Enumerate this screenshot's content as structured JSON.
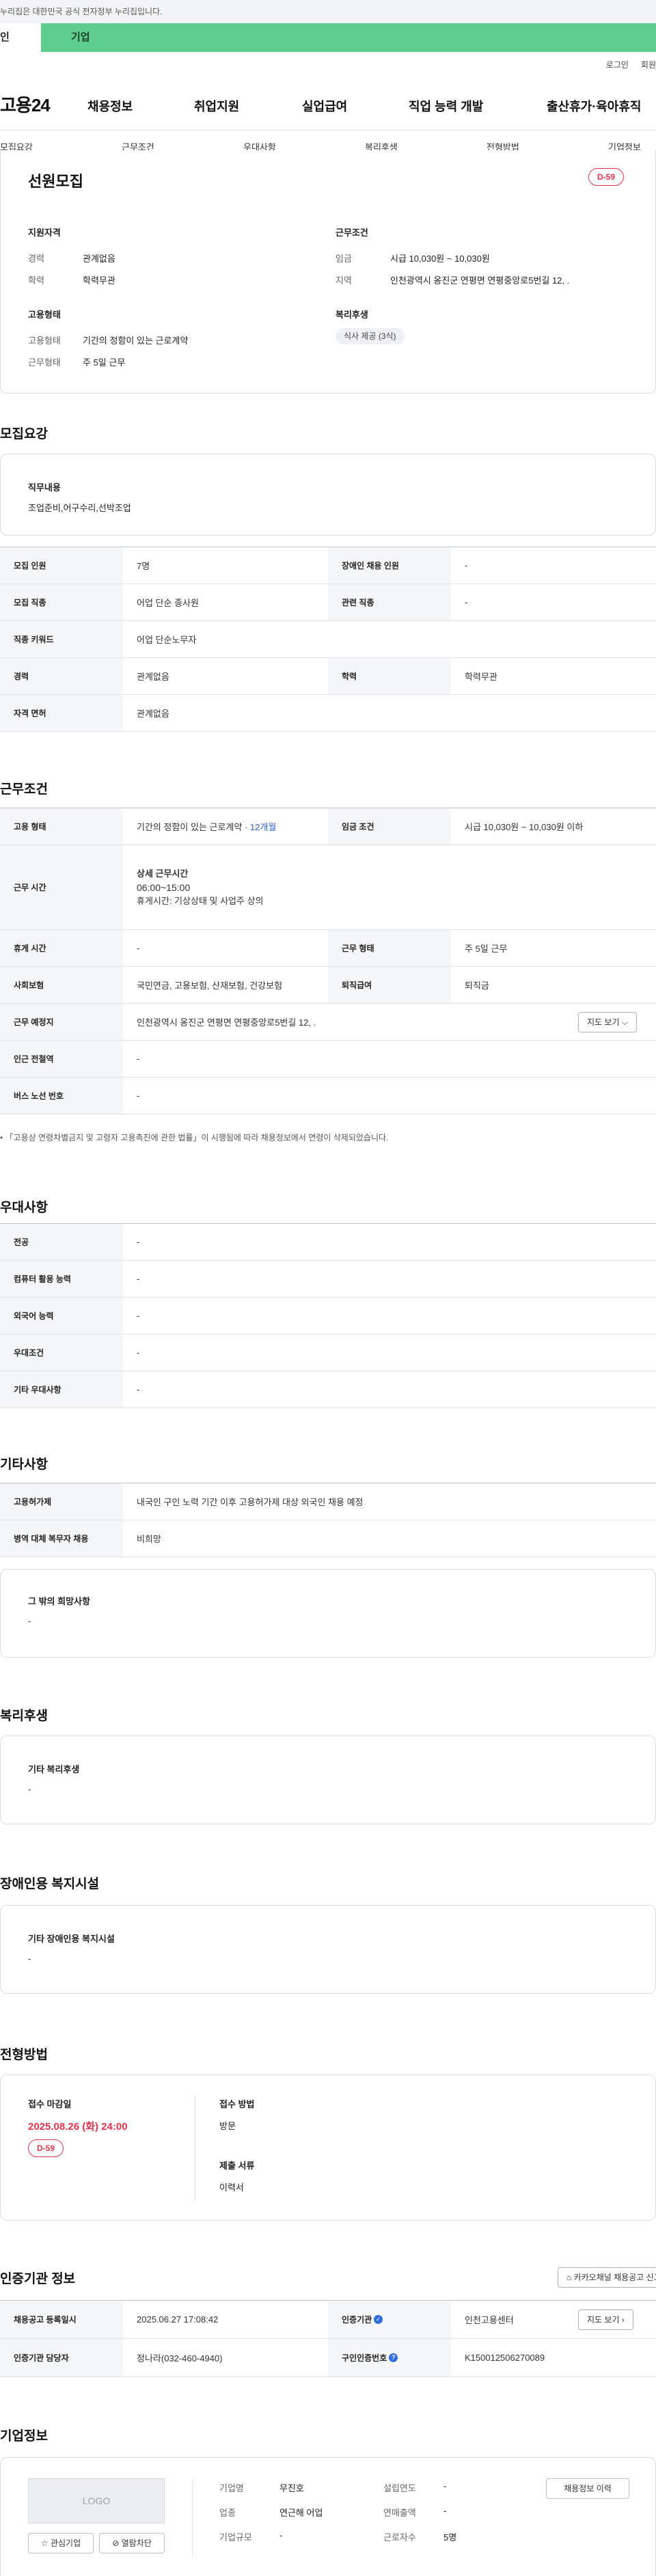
{
  "banner": {
    "gov_text": "누리집은 대한민국 공식 전자정부 누리집입니다."
  },
  "tabs": {
    "individual": "인",
    "company": "기업"
  },
  "util": {
    "login": "로그인",
    "join": "회원"
  },
  "header": {
    "logo": "고용24",
    "gnb": [
      "채용정보",
      "취업지원",
      "실업급여",
      "직업 능력 개발",
      "출산휴가·육아휴직"
    ]
  },
  "subnav": [
    "모집요강",
    "근무조건",
    "우대사항",
    "복리후생",
    "전형방법",
    "기업정보"
  ],
  "summary": {
    "title": "선원모집",
    "dday": "D-59",
    "qual_heading": "지원자격",
    "career_k": "경력",
    "career_v": "관계없음",
    "edu_k": "학력",
    "edu_v": "학력무관",
    "emp_heading": "고용형태",
    "emptype_k": "고용형태",
    "emptype_v": "기간의 정함이 있는 근로계약",
    "workdays_k": "근무형태",
    "workdays_v": "주 5일 근무",
    "cond_heading": "근무조건",
    "wage_k": "임금",
    "wage_v": "시급 10,030원 ~ 10,030원",
    "region_k": "지역",
    "region_v": "인천광역시 옹진군 연평면 연평중앙로5번길 12, .",
    "welfare_heading": "복리후생",
    "welfare_chip": "식사 제공 (3식)"
  },
  "recruit": {
    "heading": "모집요강",
    "duty_heading": "직무내용",
    "duty_text": "조업준비,어구수리,선박조업",
    "rows": {
      "count_k": "모집 인원",
      "count_v": "7명",
      "disabled_k": "장애인 채용 인원",
      "disabled_v": "-",
      "job_k": "모집 직종",
      "job_v": "어업 단순 종사원",
      "related_k": "관련 직종",
      "related_v": "-",
      "keyword_k": "직종 키워드",
      "keyword_v": "어업 단순노무자",
      "career_k": "경력",
      "career_v": "관계없음",
      "edu_k": "학력",
      "edu_v": "학력무관",
      "license_k": "자격 면허",
      "license_v": "관계없음"
    }
  },
  "work": {
    "heading": "근무조건",
    "emp_k": "고용 형태",
    "emp_v": "기간의 정함이 있는 근로계약 ·",
    "emp_months": "12개월",
    "wage_k": "임금 조건",
    "wage_v": "시급 10,030원 ~ 10,030원 이하",
    "hours_k": "근무 시간",
    "hours_title": "상세 근무시간",
    "hours_time": "06:00~15:00",
    "hours_rest": "휴게시간: 기상상태 및 사업주 상의",
    "rest_k": "휴게 시간",
    "rest_v": "-",
    "form_k": "근무 형태",
    "form_v": "주 5일 근무",
    "insurance_k": "사회보험",
    "insurance_v": "국민연금, 고용보험, 산재보험, 건강보험",
    "severance_k": "퇴직급여",
    "severance_v": "퇴직금",
    "place_k": "근무 예정지",
    "place_v": "인천광역시 옹진군 연평면 연평중앙로5번길 12, .",
    "map_btn": "지도 보기",
    "station_k": "인근 전철역",
    "station_v": "-",
    "bus_k": "버스 노선 번호",
    "bus_v": "-",
    "note": "「고용상 연령차별금지 및 고령자 고용촉진에 관한 법률」이 시행됨에 따라 채용정보에서 연령이 삭제되었습니다."
  },
  "prefer": {
    "heading": "우대사항",
    "major_k": "전공",
    "major_v": "-",
    "computer_k": "컴퓨터 활용 능력",
    "computer_v": "-",
    "lang_k": "외국어 능력",
    "lang_v": "-",
    "cond_k": "우대조건",
    "cond_v": "-",
    "etc_k": "기타 우대사항",
    "etc_v": "-"
  },
  "etc": {
    "heading": "기타사항",
    "permit_k": "고용허가제",
    "permit_v": "내국인 구인 노력 기간 이후 고용허가제 대상 외국인 채용 예정",
    "military_k": "병역 대체 복무자 채용",
    "military_v": "비희망",
    "other_heading": "그 밖의 희망사항",
    "other_v": "-"
  },
  "welfare": {
    "heading": "복리후생",
    "sub": "기타 복리후생",
    "value": "-"
  },
  "facility": {
    "heading": "장애인용 복지시설",
    "sub": "기타 장애인용 복지시설",
    "value": "-"
  },
  "selection": {
    "heading": "전형방법",
    "deadline_k": "접수 마감일",
    "deadline_v": "2025.08.26 (화) 24:00",
    "dday": "D-59",
    "method_k": "접수 방법",
    "method_v": "방문",
    "docs_k": "제출 서류",
    "docs_v": "이력서"
  },
  "agency": {
    "heading": "인증기관 정보",
    "kakao_btn": "카카오채널 채용공고 신고",
    "reg_k": "채용공고 등록일시",
    "reg_v": "2025.06.27 17:08:42",
    "agency_k": "인증기관",
    "agency_v": "인천고용센터",
    "map_btn": "지도 보기",
    "manager_k": "인증기관 담당자",
    "manager_v": "정나라(032-460-4940)",
    "id_k": "구인인증번호",
    "id_v": "K150012506270089"
  },
  "company": {
    "heading": "기업정보",
    "logo": "LOGO",
    "fav_btn": "관심기업",
    "block_btn": "열람차단",
    "name_k": "기업명",
    "name_v": "무진호",
    "industry_k": "업종",
    "industry_v": "연근해 어업",
    "size_k": "기업규모",
    "size_v": "-",
    "founded_k": "설립연도",
    "founded_v": "-",
    "sales_k": "연매출액",
    "sales_v": "-",
    "staff_k": "근로자수",
    "staff_v": "5명",
    "history_btn": "채용정보 이력"
  }
}
